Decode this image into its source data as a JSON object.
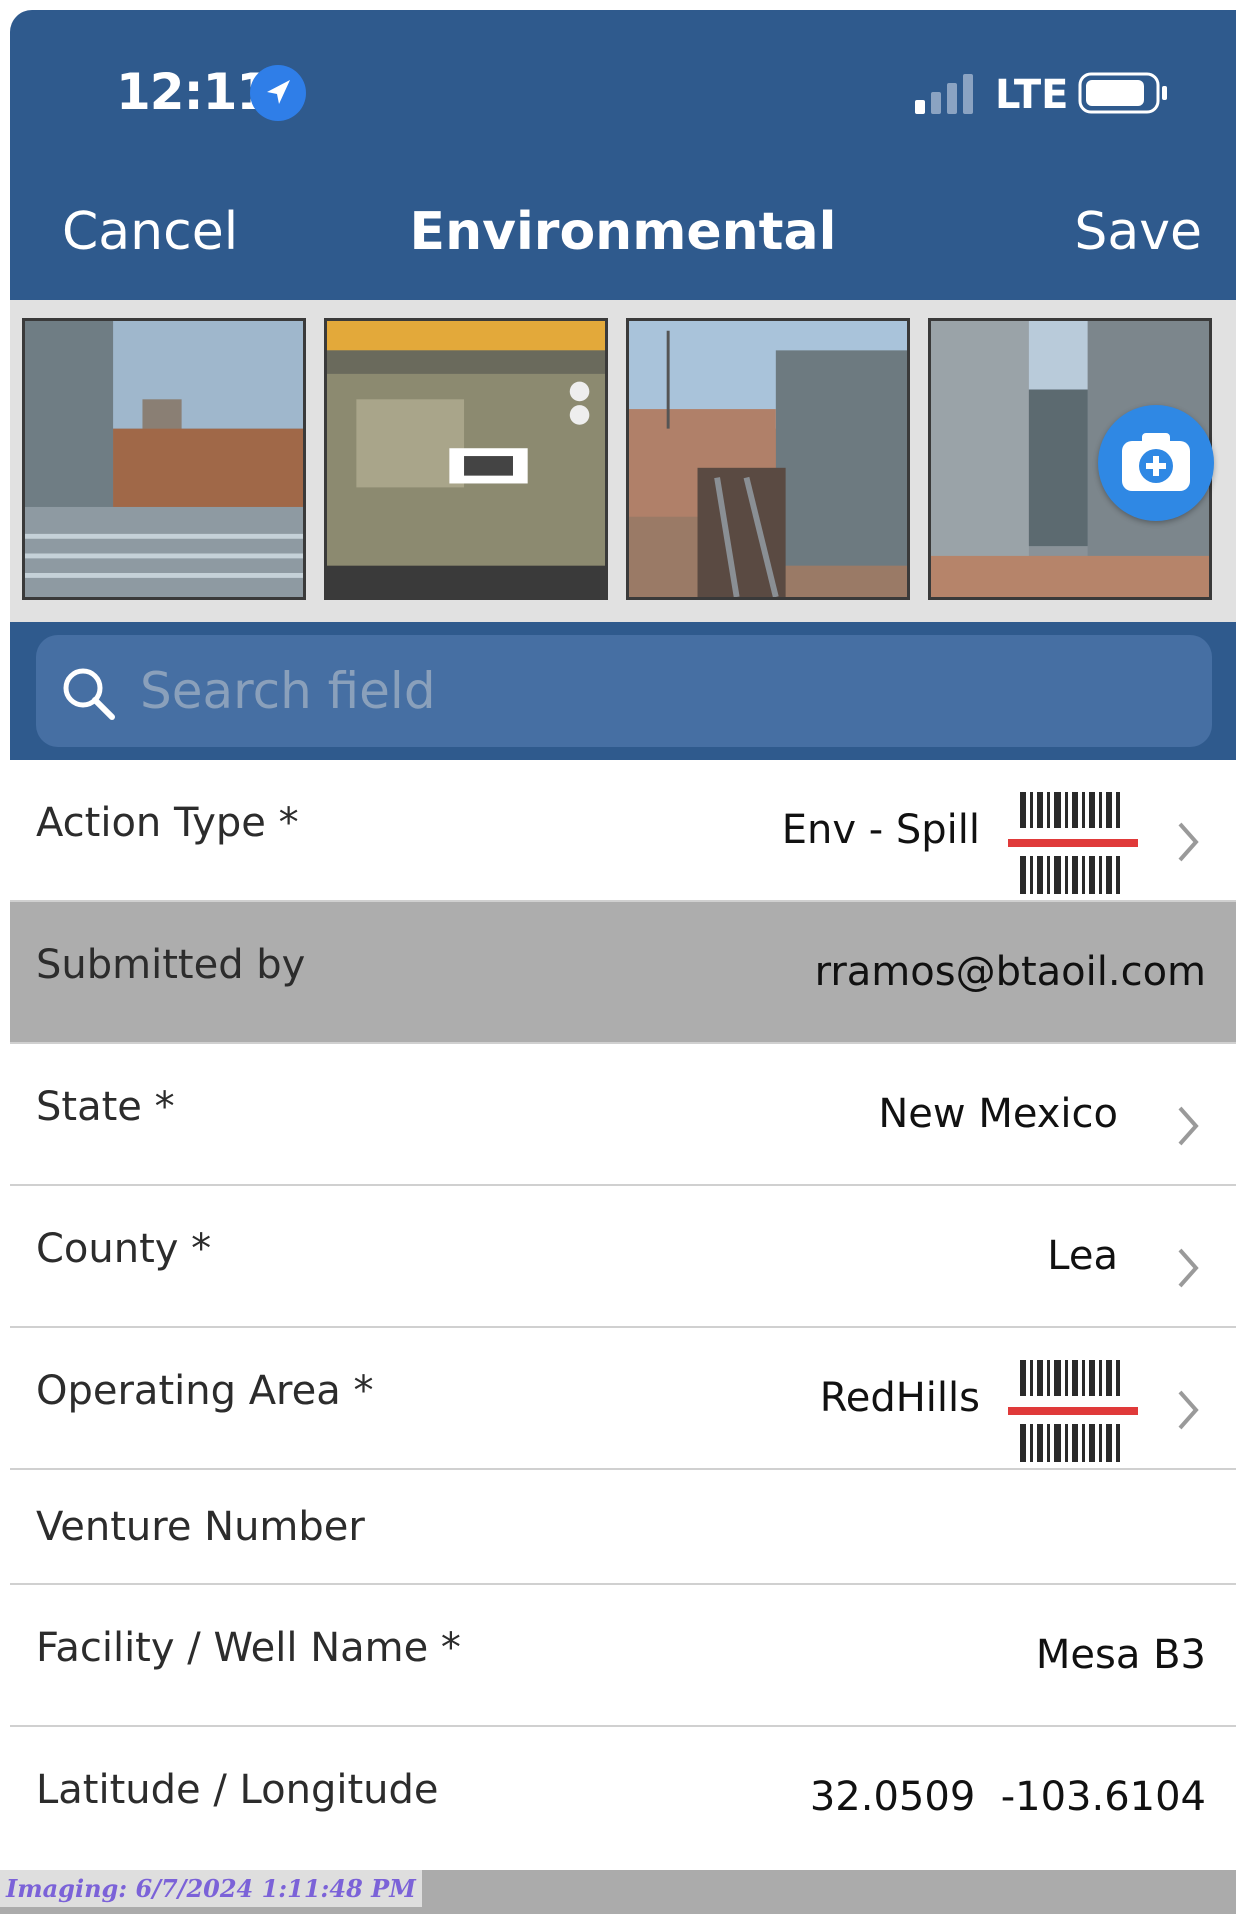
{
  "status_bar": {
    "time": "12:11",
    "network": "LTE",
    "icons": [
      "location-arrow-icon",
      "signal-icon",
      "battery-icon"
    ]
  },
  "nav": {
    "cancel_label": "Cancel",
    "title": "Environmental",
    "save_label": "Save"
  },
  "photos": [
    {
      "icon": "photo-tank-equipment"
    },
    {
      "icon": "photo-map-screenshot"
    },
    {
      "icon": "photo-tank-trench"
    },
    {
      "icon": "photo-tank-closeup"
    }
  ],
  "camera_button": {
    "icon": "camera-add-icon"
  },
  "search": {
    "placeholder": "Search field",
    "value": ""
  },
  "form": {
    "action_type": {
      "label": "Action Type *",
      "value": "Env - Spill"
    },
    "submitted_by": {
      "label": "Submitted by",
      "value": "rramos@btaoil.com"
    },
    "state": {
      "label": "State *",
      "value": "New Mexico"
    },
    "county": {
      "label": "County *",
      "value": "Lea"
    },
    "operating_area": {
      "label": "Operating Area *",
      "value": "RedHills"
    },
    "venture_number": {
      "label": "Venture Number",
      "value": ""
    },
    "facility_well_name": {
      "label": "Facility / Well Name *",
      "value": "Mesa B3"
    },
    "lat_long": {
      "label": "Latitude / Longitude",
      "value": "32.0509  -103.6104"
    }
  },
  "watermark": "Imaging: 6/7/2024 1:11:48 PM",
  "colors": {
    "header": "#2f5a8d",
    "search_field": "#466fa3",
    "camera_button": "#2f88e4",
    "readonly_row": "#adadad",
    "barcode_scan_line": "#e03a3a"
  }
}
